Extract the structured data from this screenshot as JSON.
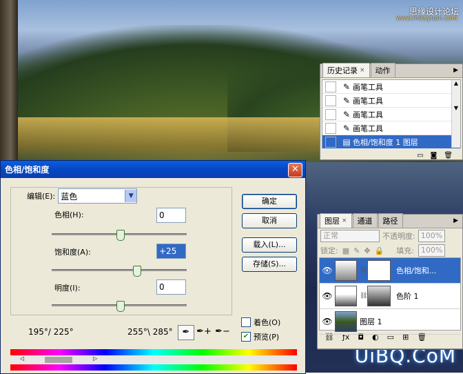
{
  "watermark": {
    "text": "思缘设计论坛",
    "sub": "www.missyuan.com",
    "logo": "UiBQ.CoM"
  },
  "history": {
    "tabs": [
      {
        "label": "历史记录"
      },
      {
        "label": "动作"
      }
    ],
    "items": [
      {
        "label": "画笔工具"
      },
      {
        "label": "画笔工具"
      },
      {
        "label": "画笔工具"
      },
      {
        "label": "画笔工具"
      },
      {
        "label": "色相/饱和度 1 图层"
      }
    ]
  },
  "layers": {
    "tabs": [
      {
        "label": "图层"
      },
      {
        "label": "通道"
      },
      {
        "label": "路径"
      }
    ],
    "blend_mode": "正常",
    "opacity_label": "不透明度:",
    "opacity_value": "100%",
    "lock_label": "锁定:",
    "fill_label": "填充:",
    "fill_value": "100%",
    "items": [
      {
        "label": "色相/饱和..."
      },
      {
        "label": "色阶 1"
      },
      {
        "label": "图层 1"
      }
    ]
  },
  "dialog": {
    "title": "色相/饱和度",
    "edit_label": "编辑(E):",
    "edit_value": "蓝色",
    "hue_label": "色相(H):",
    "hue_value": "0",
    "saturation_label": "饱和度(A):",
    "saturation_value": "+25",
    "lightness_label": "明度(I):",
    "lightness_value": "0",
    "range_left": "195°/ 225°",
    "range_right": "255°\\ 285°",
    "buttons": {
      "ok": "确定",
      "cancel": "取消",
      "load": "载入(L)...",
      "save": "存储(S)..."
    },
    "colorize_label": "着色(O)",
    "preview_label": "预览(P)"
  }
}
